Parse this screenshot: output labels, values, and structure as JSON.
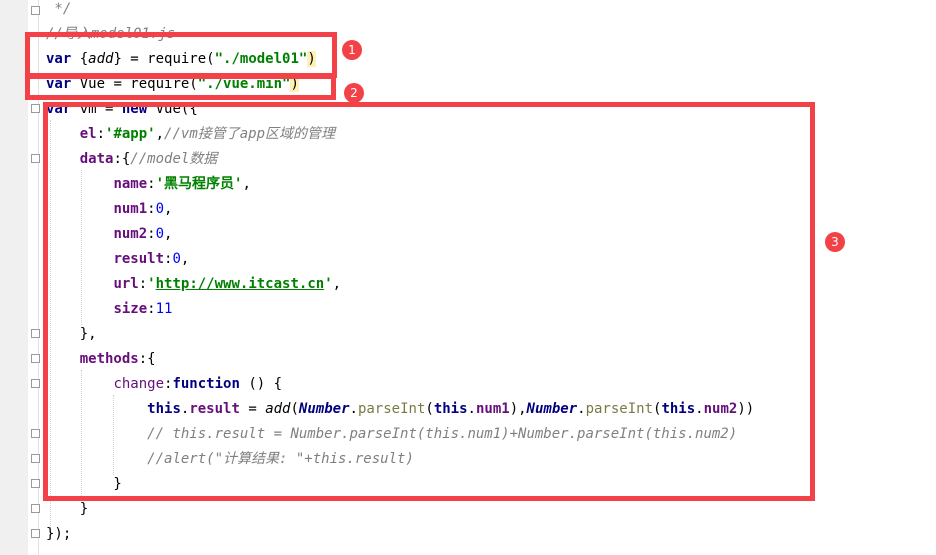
{
  "code_lines": [
    {
      "tokens": [
        {
          "t": " */",
          "c": "cmt"
        }
      ]
    },
    {
      "tokens": [
        {
          "t": "//导入model01.js",
          "c": "cmt"
        }
      ]
    },
    {
      "tokens": [
        {
          "t": "var",
          "c": "kw"
        },
        {
          "t": " {",
          "c": ""
        },
        {
          "t": "add",
          "c": "it"
        },
        {
          "t": "} = require(",
          "c": ""
        },
        {
          "t": "\"./model01\"",
          "c": "str"
        },
        {
          "t": ")",
          "c": "bracket-hl"
        }
      ]
    },
    {
      "tokens": [
        {
          "t": "var",
          "c": "kw"
        },
        {
          "t": " Vue = require(",
          "c": ""
        },
        {
          "t": "\"./vue.min\"",
          "c": "str"
        },
        {
          "t": ")",
          "c": "bracket-hl"
        }
      ]
    },
    {
      "tokens": [
        {
          "t": "var",
          "c": "kw"
        },
        {
          "t": " vm = ",
          "c": ""
        },
        {
          "t": "new",
          "c": "kw"
        },
        {
          "t": " Vue({",
          "c": ""
        }
      ]
    },
    {
      "tokens": [
        {
          "t": "    ",
          "c": ""
        },
        {
          "t": "el",
          "c": "prop"
        },
        {
          "t": ":",
          "c": ""
        },
        {
          "t": "'#app'",
          "c": "str"
        },
        {
          "t": ",",
          "c": ""
        },
        {
          "t": "//vm接管了app区域的管理",
          "c": "cmt"
        }
      ]
    },
    {
      "tokens": [
        {
          "t": "    ",
          "c": ""
        },
        {
          "t": "data",
          "c": "prop"
        },
        {
          "t": ":{",
          "c": ""
        },
        {
          "t": "//model数据",
          "c": "cmt"
        }
      ]
    },
    {
      "tokens": [
        {
          "t": "        ",
          "c": ""
        },
        {
          "t": "name",
          "c": "prop"
        },
        {
          "t": ":",
          "c": ""
        },
        {
          "t": "'黑马程序员'",
          "c": "str"
        },
        {
          "t": ",",
          "c": ""
        }
      ]
    },
    {
      "tokens": [
        {
          "t": "        ",
          "c": ""
        },
        {
          "t": "num1",
          "c": "prop"
        },
        {
          "t": ":",
          "c": ""
        },
        {
          "t": "0",
          "c": "num"
        },
        {
          "t": ",",
          "c": ""
        }
      ]
    },
    {
      "tokens": [
        {
          "t": "        ",
          "c": ""
        },
        {
          "t": "num2",
          "c": "prop"
        },
        {
          "t": ":",
          "c": ""
        },
        {
          "t": "0",
          "c": "num"
        },
        {
          "t": ",",
          "c": ""
        }
      ]
    },
    {
      "tokens": [
        {
          "t": "        ",
          "c": ""
        },
        {
          "t": "result",
          "c": "prop"
        },
        {
          "t": ":",
          "c": ""
        },
        {
          "t": "0",
          "c": "num"
        },
        {
          "t": ",",
          "c": ""
        }
      ]
    },
    {
      "tokens": [
        {
          "t": "        ",
          "c": ""
        },
        {
          "t": "url",
          "c": "prop"
        },
        {
          "t": ":",
          "c": ""
        },
        {
          "t": "'",
          "c": "str"
        },
        {
          "t": "http://www.itcast.cn",
          "c": "str url"
        },
        {
          "t": "'",
          "c": "str"
        },
        {
          "t": ",",
          "c": ""
        }
      ]
    },
    {
      "tokens": [
        {
          "t": "        ",
          "c": ""
        },
        {
          "t": "size",
          "c": "prop"
        },
        {
          "t": ":",
          "c": ""
        },
        {
          "t": "11",
          "c": "num"
        }
      ]
    },
    {
      "tokens": [
        {
          "t": "    },",
          "c": ""
        }
      ]
    },
    {
      "tokens": [
        {
          "t": "    ",
          "c": ""
        },
        {
          "t": "methods",
          "c": "prop"
        },
        {
          "t": ":{",
          "c": ""
        }
      ]
    },
    {
      "tokens": [
        {
          "t": "        ",
          "c": ""
        },
        {
          "t": "change",
          "c": "prop-fn"
        },
        {
          "t": ":",
          "c": ""
        },
        {
          "t": "function",
          "c": "kw"
        },
        {
          "t": " () {",
          "c": ""
        }
      ]
    },
    {
      "tokens": [
        {
          "t": "            ",
          "c": ""
        },
        {
          "t": "this",
          "c": "kw"
        },
        {
          "t": ".",
          "c": ""
        },
        {
          "t": "result",
          "c": "prop"
        },
        {
          "t": " = ",
          "c": ""
        },
        {
          "t": "add",
          "c": "it"
        },
        {
          "t": "(",
          "c": ""
        },
        {
          "t": "Number",
          "c": "obj"
        },
        {
          "t": ".",
          "c": ""
        },
        {
          "t": "parseInt",
          "c": "call"
        },
        {
          "t": "(",
          "c": ""
        },
        {
          "t": "this",
          "c": "kw"
        },
        {
          "t": ".",
          "c": ""
        },
        {
          "t": "num1",
          "c": "prop"
        },
        {
          "t": "),",
          "c": ""
        },
        {
          "t": "Number",
          "c": "obj"
        },
        {
          "t": ".",
          "c": ""
        },
        {
          "t": "parseInt",
          "c": "call"
        },
        {
          "t": "(",
          "c": ""
        },
        {
          "t": "this",
          "c": "kw"
        },
        {
          "t": ".",
          "c": ""
        },
        {
          "t": "num2",
          "c": "prop"
        },
        {
          "t": "))",
          "c": ""
        }
      ]
    },
    {
      "tokens": [
        {
          "t": "            ",
          "c": ""
        },
        {
          "t": "// this.result = Number.parseInt(this.num1)+Number.parseInt(this.num2)",
          "c": "cmt"
        }
      ]
    },
    {
      "tokens": [
        {
          "t": "            ",
          "c": ""
        },
        {
          "t": "//alert(\"计算结果: \"+this.result)",
          "c": "cmt"
        }
      ]
    },
    {
      "tokens": [
        {
          "t": "        }",
          "c": ""
        }
      ]
    },
    {
      "tokens": [
        {
          "t": "    }",
          "c": ""
        }
      ]
    },
    {
      "tokens": [
        {
          "t": "});",
          "c": ""
        }
      ]
    }
  ],
  "annotations": [
    {
      "label": "1"
    },
    {
      "label": "2"
    },
    {
      "label": "3"
    }
  ],
  "colors": {
    "annotation": "#f24147",
    "keyword": "#000080",
    "property": "#660e7a",
    "string": "#008000",
    "number": "#0000ff",
    "comment": "#808080"
  }
}
